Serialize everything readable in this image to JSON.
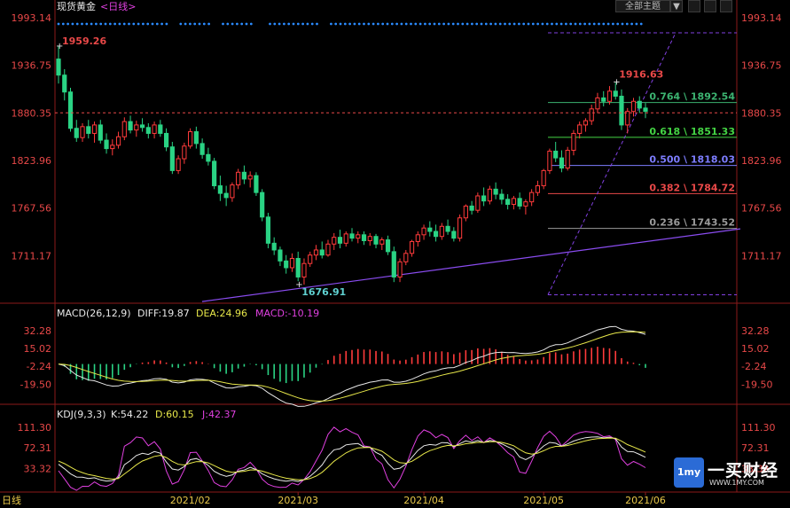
{
  "header": {
    "title": "现货黄金",
    "period": "<日线>",
    "theme_button": "全部主题",
    "theme_arrow": "▼"
  },
  "watermark": {
    "icon_text": "1my",
    "brand": "一买财经",
    "url": "WWW.1MY.COM"
  },
  "chart_data": [
    {
      "type": "candlestick",
      "title": "现货黄金 <日线>",
      "y_ticks": [
        "1993.14",
        "1936.75",
        "1880.35",
        "1823.96",
        "1767.56",
        "1711.17"
      ],
      "ylim": [
        1655,
        1995
      ],
      "x_ticks": [
        "2021/02",
        "2021/03",
        "2021/04",
        "2021/05",
        "2021/06"
      ],
      "annotations": {
        "high_label": "1959.26",
        "low_label": "1676.91",
        "recent_high_label": "1916.63",
        "current_price": "1880.35"
      },
      "fibonacci": [
        {
          "label": "0.764 \\ 1892.54",
          "value": 1892.54,
          "color": "#3cb371"
        },
        {
          "label": "0.618 \\ 1851.33",
          "value": 1851.33,
          "color": "#44d444"
        },
        {
          "label": "0.500 \\ 1818.03",
          "value": 1818.03,
          "color": "#7d7dff"
        },
        {
          "label": "0.382 \\ 1784.72",
          "value": 1784.72,
          "color": "#e84848"
        },
        {
          "label": "0.236 \\ 1743.52",
          "value": 1743.52,
          "color": "#9a9a9a"
        }
      ],
      "candles": [
        [
          1944,
          1959,
          1915,
          1925
        ],
        [
          1925,
          1932,
          1895,
          1905
        ],
        [
          1905,
          1910,
          1858,
          1862
        ],
        [
          1862,
          1872,
          1846,
          1851
        ],
        [
          1851,
          1868,
          1846,
          1864
        ],
        [
          1864,
          1872,
          1850,
          1856
        ],
        [
          1856,
          1870,
          1845,
          1866
        ],
        [
          1866,
          1872,
          1844,
          1848
        ],
        [
          1848,
          1856,
          1832,
          1838
        ],
        [
          1838,
          1849,
          1830,
          1842
        ],
        [
          1842,
          1858,
          1838,
          1852
        ],
        [
          1852,
          1875,
          1848,
          1870
        ],
        [
          1870,
          1877,
          1856,
          1860
        ],
        [
          1860,
          1871,
          1852,
          1866
        ],
        [
          1866,
          1874,
          1858,
          1863
        ],
        [
          1863,
          1868,
          1850,
          1856
        ],
        [
          1856,
          1870,
          1850,
          1866
        ],
        [
          1866,
          1872,
          1852,
          1856
        ],
        [
          1856,
          1862,
          1835,
          1840
        ],
        [
          1840,
          1846,
          1808,
          1812
        ],
        [
          1812,
          1830,
          1808,
          1826
        ],
        [
          1826,
          1845,
          1820,
          1841
        ],
        [
          1841,
          1862,
          1838,
          1858
        ],
        [
          1858,
          1864,
          1838,
          1844
        ],
        [
          1844,
          1850,
          1826,
          1831
        ],
        [
          1831,
          1839,
          1818,
          1823
        ],
        [
          1823,
          1827,
          1790,
          1794
        ],
        [
          1794,
          1806,
          1776,
          1785
        ],
        [
          1785,
          1794,
          1770,
          1780
        ],
        [
          1780,
          1798,
          1775,
          1795
        ],
        [
          1795,
          1814,
          1790,
          1810
        ],
        [
          1810,
          1818,
          1796,
          1802
        ],
        [
          1802,
          1811,
          1792,
          1806
        ],
        [
          1806,
          1810,
          1782,
          1786
        ],
        [
          1786,
          1790,
          1752,
          1757
        ],
        [
          1757,
          1762,
          1720,
          1726
        ],
        [
          1726,
          1733,
          1712,
          1718
        ],
        [
          1718,
          1722,
          1699,
          1705
        ],
        [
          1705,
          1712,
          1690,
          1697
        ],
        [
          1697,
          1714,
          1692,
          1708
        ],
        [
          1708,
          1716,
          1681,
          1686
        ],
        [
          1686,
          1708,
          1677,
          1702
        ],
        [
          1702,
          1716,
          1698,
          1712
        ],
        [
          1712,
          1724,
          1706,
          1718
        ],
        [
          1718,
          1728,
          1708,
          1712
        ],
        [
          1712,
          1730,
          1710,
          1725
        ],
        [
          1725,
          1738,
          1718,
          1733
        ],
        [
          1733,
          1742,
          1720,
          1726
        ],
        [
          1726,
          1740,
          1722,
          1737
        ],
        [
          1737,
          1744,
          1728,
          1732
        ],
        [
          1732,
          1740,
          1726,
          1736
        ],
        [
          1736,
          1740,
          1724,
          1729
        ],
        [
          1729,
          1738,
          1723,
          1734
        ],
        [
          1734,
          1737,
          1720,
          1725
        ],
        [
          1725,
          1733,
          1718,
          1730
        ],
        [
          1730,
          1735,
          1712,
          1716
        ],
        [
          1716,
          1722,
          1680,
          1686
        ],
        [
          1686,
          1708,
          1680,
          1704
        ],
        [
          1704,
          1718,
          1700,
          1714
        ],
        [
          1714,
          1730,
          1710,
          1728
        ],
        [
          1728,
          1740,
          1722,
          1736
        ],
        [
          1736,
          1748,
          1730,
          1744
        ],
        [
          1744,
          1752,
          1734,
          1740
        ],
        [
          1740,
          1748,
          1728,
          1734
        ],
        [
          1734,
          1750,
          1730,
          1746
        ],
        [
          1746,
          1754,
          1736,
          1740
        ],
        [
          1740,
          1745,
          1728,
          1732
        ],
        [
          1732,
          1760,
          1728,
          1756
        ],
        [
          1756,
          1772,
          1752,
          1770
        ],
        [
          1770,
          1776,
          1760,
          1765
        ],
        [
          1765,
          1786,
          1762,
          1782
        ],
        [
          1782,
          1792,
          1770,
          1776
        ],
        [
          1776,
          1794,
          1772,
          1790
        ],
        [
          1790,
          1798,
          1778,
          1784
        ],
        [
          1784,
          1790,
          1772,
          1778
        ],
        [
          1778,
          1784,
          1766,
          1772
        ],
        [
          1772,
          1782,
          1766,
          1779
        ],
        [
          1779,
          1786,
          1766,
          1770
        ],
        [
          1770,
          1778,
          1760,
          1775
        ],
        [
          1775,
          1790,
          1770,
          1786
        ],
        [
          1786,
          1800,
          1782,
          1794
        ],
        [
          1794,
          1814,
          1790,
          1812
        ],
        [
          1812,
          1838,
          1808,
          1835
        ],
        [
          1835,
          1846,
          1822,
          1827
        ],
        [
          1827,
          1836,
          1810,
          1815
        ],
        [
          1815,
          1840,
          1812,
          1836
        ],
        [
          1836,
          1860,
          1830,
          1856
        ],
        [
          1856,
          1870,
          1850,
          1866
        ],
        [
          1866,
          1874,
          1858,
          1871
        ],
        [
          1871,
          1890,
          1866,
          1885
        ],
        [
          1885,
          1904,
          1880,
          1898
        ],
        [
          1898,
          1906,
          1888,
          1894
        ],
        [
          1894,
          1912,
          1890,
          1906
        ],
        [
          1906,
          1916,
          1896,
          1900
        ],
        [
          1900,
          1908,
          1860,
          1866
        ],
        [
          1866,
          1886,
          1856,
          1882
        ],
        [
          1882,
          1898,
          1876,
          1894
        ],
        [
          1894,
          1900,
          1880,
          1886
        ],
        [
          1886,
          1892,
          1874,
          1882
        ]
      ]
    },
    {
      "type": "line",
      "title": "MACD(26,12,9)",
      "legend": [
        {
          "text": "DIFF:19.87",
          "color": "#e8e8e8"
        },
        {
          "text": "DEA:24.96",
          "color": "#e8e84a"
        },
        {
          "text": "MACD:-10.19",
          "color": "#e040e0"
        }
      ],
      "y_ticks": [
        "32.28",
        "15.02",
        "-2.24",
        "-19.50"
      ],
      "ylim": [
        -38,
        45
      ]
    },
    {
      "type": "line",
      "title": "KDJ(9,3,3)",
      "legend": [
        {
          "text": "K:54.22",
          "color": "#e8e8e8"
        },
        {
          "text": "D:60.15",
          "color": "#e8e84a"
        },
        {
          "text": "J:42.37",
          "color": "#e040e0"
        }
      ],
      "y_ticks": [
        "111.30",
        "72.31",
        "33.32"
      ],
      "ylim": [
        -10,
        128
      ]
    }
  ],
  "footer": {
    "period_label": "日线"
  }
}
